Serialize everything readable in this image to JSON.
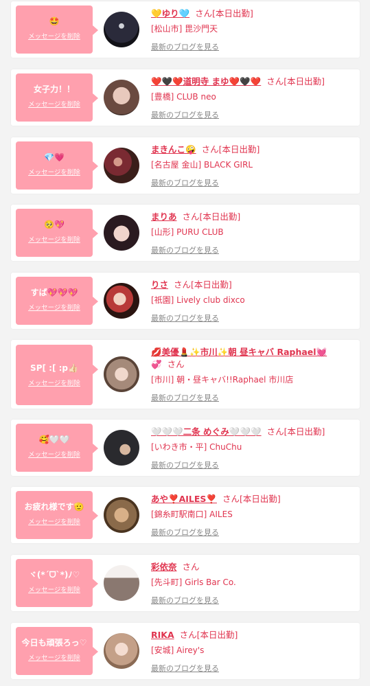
{
  "delete_label": "メッセージを削除",
  "blog_label": "最新のブログを見る",
  "san_label": "さん",
  "entries": [
    {
      "message": "🤩",
      "name": "💛ゆり🩵",
      "badge": "[本日出勤]",
      "shop": "[松山市] 毘沙門天",
      "avatar_color": "#2a2a3a"
    },
    {
      "message": "女子力！！",
      "name": "❤️🖤❤️道明寺 まゆ❤️🖤❤️",
      "badge": "[本日出勤]",
      "shop": "[豊橋] CLUB neo",
      "avatar_color": "#c9a79a"
    },
    {
      "message": "💎💗",
      "name": "まきんこ🤪",
      "badge": "[本日出勤]",
      "shop": "[名古屋 金山] BLACK GIRL",
      "avatar_color": "#7a2a32"
    },
    {
      "message": "🥺💖",
      "name": "まりあ",
      "badge": "[本日出勤]",
      "shop": "[山形] PURU CLUB",
      "avatar_color": "#3a2a30"
    },
    {
      "message": "すば💖💖💖",
      "name": "りさ",
      "badge": "[本日出勤]",
      "shop": "[祇園] Lively club dixco",
      "avatar_color": "#5a2a22"
    },
    {
      "message": "SP[ :[ :p👍🏻",
      "name": "💋美優💄✨市川✨朝 昼キャバ Raphael💓",
      "name_cont": "💞",
      "badge": "",
      "shop": "[市川] 朝・昼キャバ!!Raphael 市川店",
      "avatar_color": "#a58a7a"
    },
    {
      "message": "🥰🤍🤍",
      "name": "🤍🤍🤍二条 めぐみ🤍🤍🤍",
      "badge": "[本日出勤]",
      "shop": "[いわき市・平] ChuChu",
      "avatar_color": "#2a2a2e"
    },
    {
      "message": "お疲れ様です🫡",
      "name": "あや❣️AILES❣️",
      "badge": "[本日出勤]",
      "shop": "[錦糸町駅南口] AILES",
      "avatar_color": "#8a6a4a"
    },
    {
      "message": "ヾ(*ˊᗜˋ*)ﾉ♡",
      "name": "彩依奈",
      "badge": "",
      "shop": "[先斗町] Girls Bar Co.",
      "avatar_color": "#b0a098"
    },
    {
      "message": "今日も頑張ろっ♡",
      "name": "RIKA",
      "badge": "[本日出勤]",
      "shop": "[安城] Airey's",
      "avatar_color": "#c4a088"
    }
  ]
}
